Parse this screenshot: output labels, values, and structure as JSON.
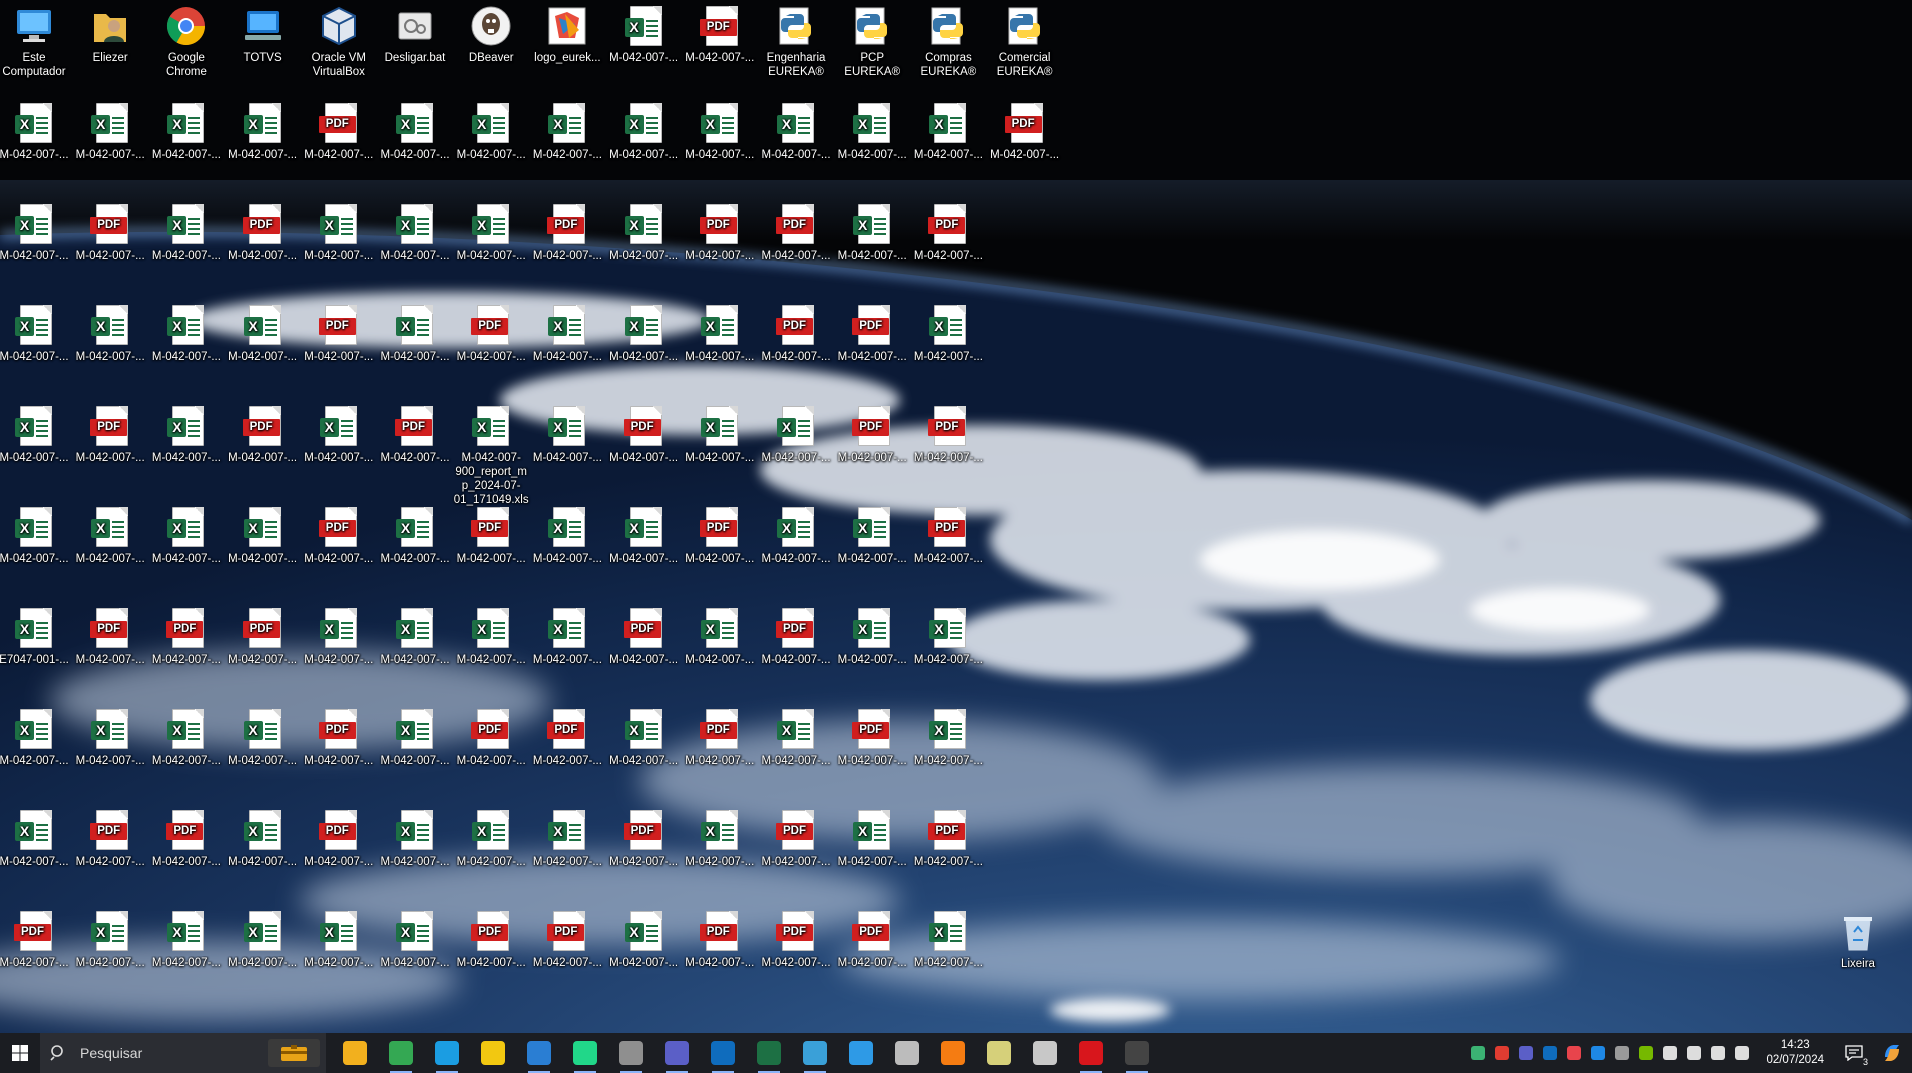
{
  "desktop": {
    "shortcuts": [
      {
        "label": "Este Computador",
        "icon": "computer-icon"
      },
      {
        "label": "Eliezer",
        "icon": "user-folder-icon"
      },
      {
        "label": "Google Chrome",
        "icon": "chrome-icon"
      },
      {
        "label": "TOTVS",
        "icon": "totvs-icon"
      },
      {
        "label": "Oracle VM VirtualBox",
        "icon": "virtualbox-icon"
      },
      {
        "label": "Desligar.bat",
        "icon": "batch-file-icon"
      },
      {
        "label": "DBeaver",
        "icon": "dbeaver-icon"
      },
      {
        "label": "logo_eurek...",
        "icon": "image-file-icon"
      },
      {
        "label": "M-042-007-...",
        "icon": "excel-file-icon"
      },
      {
        "label": "M-042-007-...",
        "icon": "pdf-file-icon"
      },
      {
        "label": "Engenharia EUREKA®",
        "icon": "python-icon"
      },
      {
        "label": "PCP EUREKA®",
        "icon": "python-icon"
      },
      {
        "label": "Compras EUREKA®",
        "icon": "python-icon"
      },
      {
        "label": "Comercial EUREKA®",
        "icon": "python-icon"
      }
    ],
    "file_rows": [
      {
        "types": [
          "x",
          "x",
          "x",
          "x",
          "p",
          "x",
          "x",
          "x",
          "x",
          "x",
          "x",
          "x",
          "x",
          "p"
        ],
        "labels": [
          "M-042-007-...",
          "M-042-007-...",
          "M-042-007-...",
          "M-042-007-...",
          "M-042-007-...",
          "M-042-007-...",
          "M-042-007-...",
          "M-042-007-...",
          "M-042-007-...",
          "M-042-007-...",
          "M-042-007-...",
          "M-042-007-...",
          "M-042-007-...",
          "M-042-007-..."
        ]
      },
      {
        "types": [
          "x",
          "p",
          "x",
          "p",
          "x",
          "x",
          "x",
          "p",
          "x",
          "p",
          "p",
          "x",
          "p"
        ],
        "labels": [
          "M-042-007-...",
          "M-042-007-...",
          "M-042-007-...",
          "M-042-007-...",
          "M-042-007-...",
          "M-042-007-...",
          "M-042-007-...",
          "M-042-007-...",
          "M-042-007-...",
          "M-042-007-...",
          "M-042-007-...",
          "M-042-007-...",
          "M-042-007-..."
        ]
      },
      {
        "types": [
          "x",
          "x",
          "x",
          "x",
          "p",
          "x",
          "p",
          "x",
          "x",
          "x",
          "p",
          "p",
          "x"
        ],
        "labels": [
          "M-042-007-...",
          "M-042-007-...",
          "M-042-007-...",
          "M-042-007-...",
          "M-042-007-...",
          "M-042-007-...",
          "M-042-007-...",
          "M-042-007-...",
          "M-042-007-...",
          "M-042-007-...",
          "M-042-007-...",
          "M-042-007-...",
          "M-042-007-..."
        ]
      },
      {
        "types": [
          "x",
          "p",
          "x",
          "p",
          "x",
          "p",
          "x",
          "x",
          "p",
          "x",
          "x",
          "p",
          "p"
        ],
        "labels": [
          "M-042-007-...",
          "M-042-007-...",
          "M-042-007-...",
          "M-042-007-...",
          "M-042-007-...",
          "M-042-007-...",
          "M-042-007-900_report_mp_2024-07-01_171049.xlsx",
          "M-042-007-...",
          "M-042-007-...",
          "M-042-007-...",
          "M-042-007-...",
          "M-042-007-...",
          "M-042-007-..."
        ]
      },
      {
        "types": [
          "x",
          "x",
          "x",
          "x",
          "p",
          "x",
          "p",
          "x",
          "x",
          "p",
          "x",
          "x",
          "p"
        ],
        "labels": [
          "M-042-007-...",
          "M-042-007-...",
          "M-042-007-...",
          "M-042-007-...",
          "M-042-007-...",
          "M-042-007-...",
          "M-042-007-...",
          "M-042-007-...",
          "M-042-007-...",
          "M-042-007-...",
          "M-042-007-...",
          "M-042-007-...",
          "M-042-007-..."
        ]
      },
      {
        "types": [
          "x",
          "p",
          "p",
          "p",
          "x",
          "x",
          "x",
          "x",
          "p",
          "x",
          "p",
          "x",
          "x"
        ],
        "labels": [
          "E7047-001-...",
          "M-042-007-...",
          "M-042-007-...",
          "M-042-007-...",
          "M-042-007-...",
          "M-042-007-...",
          "M-042-007-...",
          "M-042-007-...",
          "M-042-007-...",
          "M-042-007-...",
          "M-042-007-...",
          "M-042-007-...",
          "M-042-007-..."
        ]
      },
      {
        "types": [
          "x",
          "x",
          "x",
          "x",
          "p",
          "x",
          "p",
          "p",
          "x",
          "p",
          "x",
          "p",
          "x"
        ],
        "labels": [
          "M-042-007-...",
          "M-042-007-...",
          "M-042-007-...",
          "M-042-007-...",
          "M-042-007-...",
          "M-042-007-...",
          "M-042-007-...",
          "M-042-007-...",
          "M-042-007-...",
          "M-042-007-...",
          "M-042-007-...",
          "M-042-007-...",
          "M-042-007-..."
        ]
      },
      {
        "types": [
          "x",
          "p",
          "p",
          "x",
          "p",
          "x",
          "x",
          "x",
          "p",
          "x",
          "p",
          "x",
          "p"
        ],
        "labels": [
          "M-042-007-...",
          "M-042-007-...",
          "M-042-007-...",
          "M-042-007-...",
          "M-042-007-...",
          "M-042-007-...",
          "M-042-007-...",
          "M-042-007-...",
          "M-042-007-...",
          "M-042-007-...",
          "M-042-007-...",
          "M-042-007-...",
          "M-042-007-..."
        ]
      },
      {
        "types": [
          "p",
          "x",
          "x",
          "x",
          "x",
          "x",
          "p",
          "p",
          "x",
          "p",
          "p",
          "p",
          "x"
        ],
        "labels": [
          "M-042-007-...",
          "M-042-007-...",
          "M-042-007-...",
          "M-042-007-...",
          "M-042-007-...",
          "M-042-007-...",
          "M-042-007-...",
          "M-042-007-...",
          "M-042-007-...",
          "M-042-007-...",
          "M-042-007-...",
          "M-042-007-...",
          "M-042-007-..."
        ]
      }
    ],
    "recycle_bin": {
      "label": "Lixeira",
      "icon": "recycle-bin-icon"
    },
    "file_badges": {
      "excel": "X",
      "pdf": "PDF"
    }
  },
  "taskbar": {
    "search_placeholder": "Pesquisar",
    "apps": [
      {
        "name": "file-explorer-icon",
        "color": "#f2b01e",
        "running": false
      },
      {
        "name": "chrome-icon",
        "color": "#34a853",
        "running": true
      },
      {
        "name": "edge-icon",
        "color": "#1b9de2",
        "running": true
      },
      {
        "name": "power-bi-icon",
        "color": "#f2c811",
        "running": false
      },
      {
        "name": "vscode-icon",
        "color": "#2a7ed3",
        "running": true
      },
      {
        "name": "pycharm-icon",
        "color": "#21d789",
        "running": true
      },
      {
        "name": "dbeaver-icon",
        "color": "#8f8f8f",
        "running": true
      },
      {
        "name": "teams-icon",
        "color": "#5b5fc7",
        "running": true
      },
      {
        "name": "outlook-icon",
        "color": "#0f6cbd",
        "running": true
      },
      {
        "name": "excel-icon",
        "color": "#1d7044",
        "running": true
      },
      {
        "name": "remote-desktop-icon",
        "color": "#3aa0d8",
        "running": true
      },
      {
        "name": "sql-server-icon",
        "color": "#2e9ae6",
        "running": false
      },
      {
        "name": "virtualbox-icon",
        "color": "#bcbcbc",
        "running": false
      },
      {
        "name": "sublime-icon",
        "color": "#f57c12",
        "running": false
      },
      {
        "name": "notepad-icon",
        "color": "#d6d07a",
        "running": false
      },
      {
        "name": "monitor-icon",
        "color": "#c8c8c8",
        "running": false
      },
      {
        "name": "solidworks-icon",
        "color": "#d8161c",
        "running": true
      },
      {
        "name": "terminal-icon",
        "color": "#444444",
        "running": true
      }
    ],
    "tray": [
      {
        "name": "kanban-icon",
        "color": "#3bb273"
      },
      {
        "name": "recorder-icon",
        "color": "#e03c31"
      },
      {
        "name": "teams-tray-icon",
        "color": "#5b5fc7"
      },
      {
        "name": "outlook-tray-icon",
        "color": "#0f6cbd"
      },
      {
        "name": "security-icon",
        "color": "#e8444c"
      },
      {
        "name": "onedrive-icon",
        "color": "#1e88e5"
      },
      {
        "name": "network-share-icon",
        "color": "#9a9a9a"
      },
      {
        "name": "nvidia-icon",
        "color": "#76b900"
      },
      {
        "name": "usb-icon",
        "color": "#dddddd"
      },
      {
        "name": "camera-icon",
        "color": "#dddddd"
      },
      {
        "name": "network-icon",
        "color": "#dddddd"
      },
      {
        "name": "volume-icon",
        "color": "#dddddd"
      }
    ],
    "clock": {
      "time": "14:23",
      "date": "02/07/2024"
    },
    "notifications": {
      "count": "3"
    }
  }
}
